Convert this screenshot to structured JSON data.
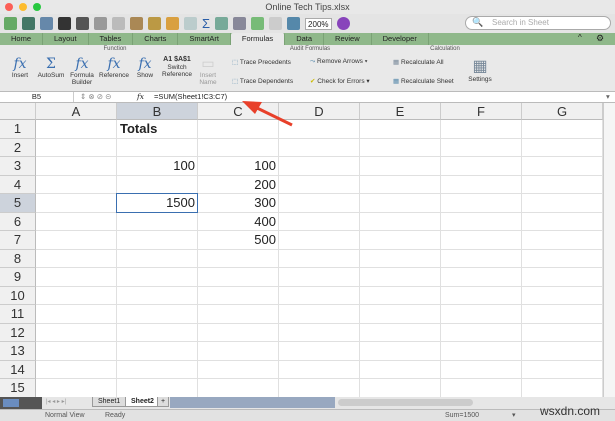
{
  "window": {
    "title": "Online Tech Tips.xlsx"
  },
  "toolbar": {
    "zoom": "200%",
    "search_placeholder": "Search in Sheet"
  },
  "tabs": [
    "Home",
    "Layout",
    "Tables",
    "Charts",
    "SmartArt",
    "Formulas",
    "Data",
    "Review",
    "Developer"
  ],
  "active_tab": "Formulas",
  "ribbon": {
    "groups": {
      "function": "Function",
      "audit": "Audit Formulas",
      "calculation": "Calculation"
    },
    "insert": "Insert",
    "autosum": "AutoSum",
    "formula_builder_1": "Formula",
    "formula_builder_2": "Builder",
    "reference": "Reference",
    "show": "Show",
    "switch_icon": "A1 $A$1",
    "switch_1": "Switch",
    "switch_2": "Reference",
    "insert_name_1": "Insert",
    "insert_name_2": "Name",
    "trace_precedents": "Trace Precedents",
    "trace_dependents": "Trace Dependents",
    "remove_arrows": "Remove Arrows",
    "check_errors": "Check for Errors",
    "recalc_all": "Recalculate All",
    "recalc_sheet": "Recalculate Sheet",
    "settings": "Settings"
  },
  "formula_bar": {
    "name_box": "B5",
    "fx": "fx",
    "formula": "=SUM(Sheet1!C3:C7)"
  },
  "grid": {
    "columns": [
      "A",
      "B",
      "C",
      "D",
      "E",
      "F",
      "G"
    ],
    "rows": [
      "1",
      "2",
      "3",
      "4",
      "5",
      "6",
      "7",
      "8",
      "9",
      "10",
      "11",
      "12",
      "13",
      "14",
      "15"
    ],
    "cells": {
      "B1": "Totals",
      "B3": "100",
      "B5": "1500",
      "C3": "100",
      "C4": "200",
      "C5": "300",
      "C6": "400",
      "C7": "500"
    },
    "selected": "B5"
  },
  "sheets": [
    "Sheet1",
    "Sheet2"
  ],
  "active_sheet": "Sheet2",
  "status": {
    "view": "Normal View",
    "state": "Ready",
    "sum": "Sum=1500"
  },
  "watermark": "wsxdn.com",
  "colors": {
    "tab_bar": "#8fb88a",
    "arrow": "#e8402a",
    "selection": "#3a6fb0"
  }
}
